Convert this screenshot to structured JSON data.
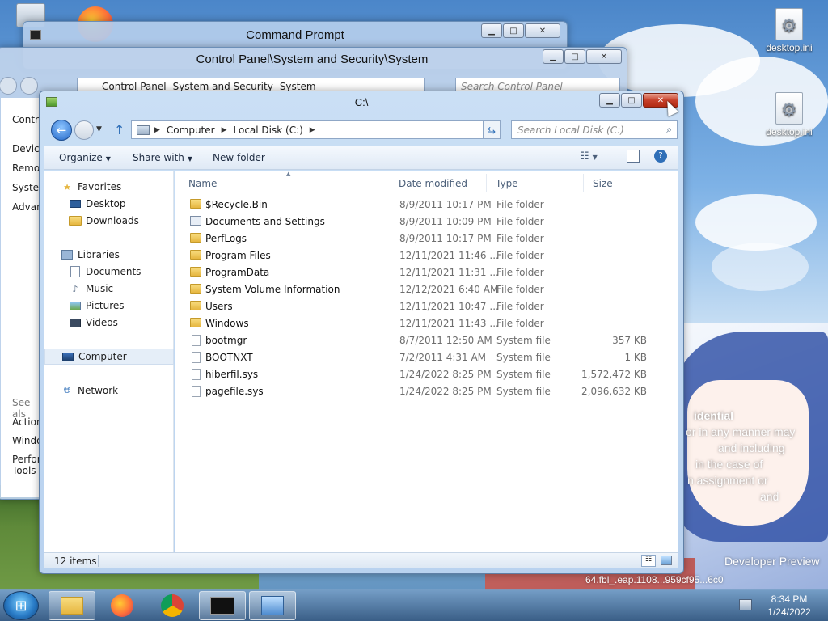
{
  "desktop": {
    "icons": [
      {
        "label": "desktop.ini"
      },
      {
        "label": "desktop.ini"
      }
    ],
    "wallpaper_text": [
      "idential",
      "or in any manner may",
      "and including",
      "in the case of",
      "n assignment or",
      "and",
      "Developer Preview",
      "64.fbl_.eap.1108...959cf95...6c0"
    ]
  },
  "cmd_window": {
    "title": "Command Prompt"
  },
  "cp_window": {
    "title": "Control Panel\\System and Security\\System",
    "breadcrumb": [
      "Control Panel",
      "System and Security",
      "System"
    ],
    "search_placeholder": "Search Control Panel",
    "side_items": [
      "Contr",
      "Device",
      "Remo",
      "Syster",
      "Advan",
      "See als",
      "Action",
      "Windo",
      "Perfor",
      "Tools"
    ]
  },
  "explorer": {
    "title": "C:\\",
    "breadcrumb": [
      "Computer",
      "Local Disk (C:)"
    ],
    "search_placeholder": "Search Local Disk (C:)",
    "toolbar": {
      "organize": "Organize",
      "share_with": "Share with",
      "new_folder": "New folder"
    },
    "nav": {
      "favorites": "Favorites",
      "desktop": "Desktop",
      "downloads": "Downloads",
      "libraries": "Libraries",
      "documents": "Documents",
      "music": "Music",
      "pictures": "Pictures",
      "videos": "Videos",
      "computer": "Computer",
      "network": "Network"
    },
    "columns": {
      "name": "Name",
      "date": "Date modified",
      "type": "Type",
      "size": "Size"
    },
    "rows": [
      {
        "name": "$Recycle.Bin",
        "date": "8/9/2011 10:17 PM",
        "type": "File folder",
        "size": "",
        "icon": "folder"
      },
      {
        "name": "Documents and Settings",
        "date": "8/9/2011 10:09 PM",
        "type": "File folder",
        "size": "",
        "icon": "link"
      },
      {
        "name": "PerfLogs",
        "date": "8/9/2011 10:17 PM",
        "type": "File folder",
        "size": "",
        "icon": "folder"
      },
      {
        "name": "Program Files",
        "date": "12/11/2021 11:46 ...",
        "type": "File folder",
        "size": "",
        "icon": "folder"
      },
      {
        "name": "ProgramData",
        "date": "12/11/2021 11:31 ...",
        "type": "File folder",
        "size": "",
        "icon": "folder"
      },
      {
        "name": "System Volume Information",
        "date": "12/12/2021 6:40 AM",
        "type": "File folder",
        "size": "",
        "icon": "folder"
      },
      {
        "name": "Users",
        "date": "12/11/2021 10:47 ...",
        "type": "File folder",
        "size": "",
        "icon": "folder"
      },
      {
        "name": "Windows",
        "date": "12/11/2021 11:43 ...",
        "type": "File folder",
        "size": "",
        "icon": "folder"
      },
      {
        "name": "bootmgr",
        "date": "8/7/2011 12:50 AM",
        "type": "System file",
        "size": "357 KB",
        "icon": "file"
      },
      {
        "name": "BOOTNXT",
        "date": "7/2/2011 4:31 AM",
        "type": "System file",
        "size": "1 KB",
        "icon": "file"
      },
      {
        "name": "hiberfil.sys",
        "date": "1/24/2022 8:25 PM",
        "type": "System file",
        "size": "1,572,472 KB",
        "icon": "file"
      },
      {
        "name": "pagefile.sys",
        "date": "1/24/2022 8:25 PM",
        "type": "System file",
        "size": "2,096,632 KB",
        "icon": "file"
      }
    ],
    "status": "12 items"
  },
  "taskbar": {
    "time": "8:34 PM",
    "date": "1/24/2022"
  }
}
